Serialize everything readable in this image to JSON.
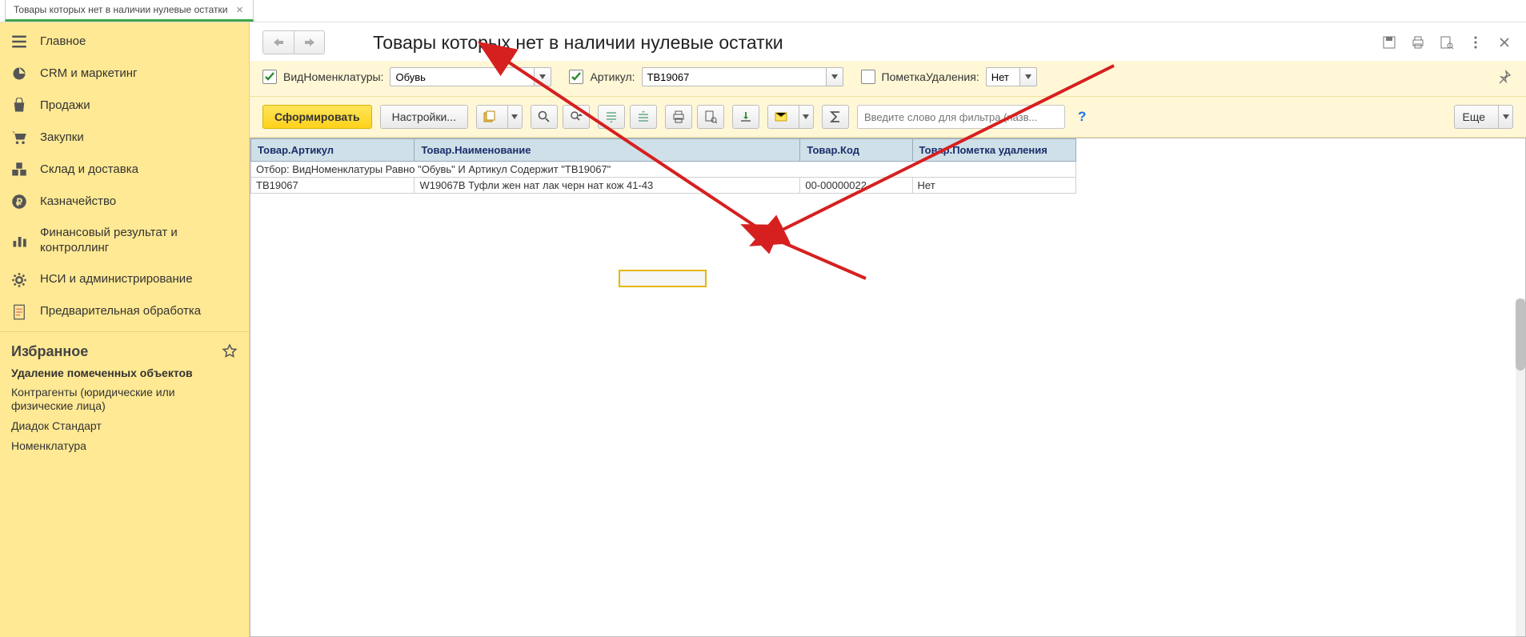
{
  "tab": {
    "title": "Товары которых нет в наличии нулевые остатки"
  },
  "sidebar": {
    "items": [
      {
        "label": "Главное"
      },
      {
        "label": "CRM и маркетинг"
      },
      {
        "label": "Продажи"
      },
      {
        "label": "Закупки"
      },
      {
        "label": "Склад и доставка"
      },
      {
        "label": "Казначейство"
      },
      {
        "label": "Финансовый результат и контроллинг"
      },
      {
        "label": "НСИ и администрирование"
      },
      {
        "label": "Предварительная обработка"
      }
    ],
    "favorites_title": "Избранное",
    "favorites": [
      "Удаление помеченных объектов",
      "Контрагенты (юридические или физические лица)",
      "Диадок Стандарт",
      "Номенклатура"
    ]
  },
  "header": {
    "title": "Товары которых нет в наличии нулевые остатки"
  },
  "filters": {
    "f1": {
      "checked": true,
      "label": "ВидНоменклатуры:",
      "value": "Обувь"
    },
    "f2": {
      "checked": true,
      "label": "Артикул:",
      "value": "ТВ19067"
    },
    "f3": {
      "checked": false,
      "label": "ПометкаУдаления:",
      "value": "Нет"
    }
  },
  "toolbar": {
    "generate": "Сформировать",
    "settings": "Настройки...",
    "more": "Еще",
    "search_placeholder": "Введите слово для фильтра (назв..."
  },
  "report": {
    "headers": [
      "Товар.Артикул",
      "Товар.Наименование",
      "Товар.Код",
      "Товар.Пометка удаления"
    ],
    "filter_text": "Отбор: ВидНоменклатуры Равно \"Обувь\" И Артикул Содержит \"ТВ19067\"",
    "rows": [
      {
        "art": "ТВ19067",
        "name": "W19067В Туфли жен нат лак черн нат кож 41-43",
        "code": "00-00000022",
        "del": "Нет"
      }
    ]
  }
}
